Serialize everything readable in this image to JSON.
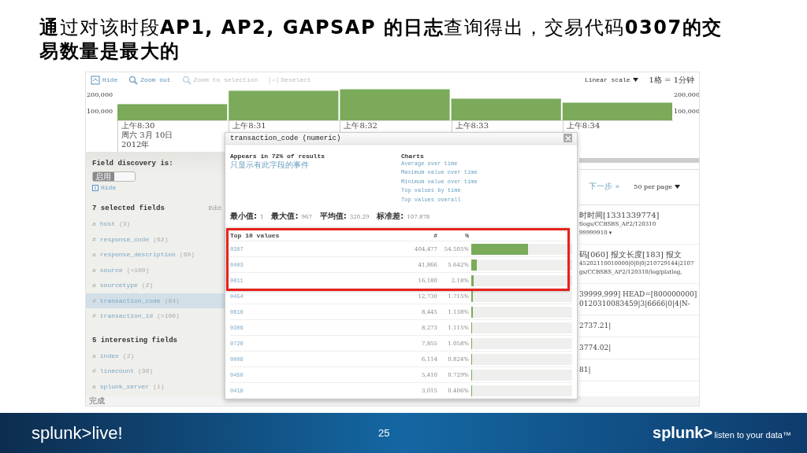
{
  "slide": {
    "title": "**通**过对该时段**AP1, AP2, GAPSAP 的日志**查询得出，交易代码**0307的交易数量是最大的**",
    "footer_logo": "splunk>live!",
    "page_number": "25",
    "footer_brand": "splunk>",
    "footer_tagline": "listen to your data™"
  },
  "toolbar": {
    "buttons": [
      {
        "kind": "hide",
        "label": "Hide",
        "disabled": false
      },
      {
        "kind": "zoom",
        "label": "Zoom out",
        "disabled": false
      },
      {
        "kind": "zoom",
        "label": "Zoom to selection",
        "disabled": true
      },
      {
        "kind": "deselect",
        "label": "Deselect",
        "disabled": true
      }
    ],
    "scale": "Linear scale",
    "bucket": "1格 = 1分钟"
  },
  "timeline": {
    "chart_data": {
      "type": "bar",
      "categories": [
        "上午8:30",
        "上午8:31",
        "上午8:32",
        "上午8:33",
        "上午8:34"
      ],
      "values": [
        148000,
        229000,
        238000,
        181000,
        157000
      ],
      "ylim": [
        50000,
        250000
      ],
      "yticks": [
        {
          "value": 100000,
          "label": "100,000"
        },
        {
          "value": 200000,
          "label": "200,000"
        }
      ]
    },
    "right_axis_labels": [
      "200,000",
      "100,000"
    ],
    "date_lines": [
      "周六 3月 10日",
      "2012年"
    ]
  },
  "sidebar": {
    "heading": "Field discovery is:",
    "toggle": {
      "label": "启用",
      "on": true
    },
    "hide": "Hide",
    "groups": [
      {
        "title": "7 selected fields",
        "action": "Edit",
        "fields": [
          {
            "type": "a",
            "name": "host",
            "count": "(3)",
            "selected": false
          },
          {
            "type": "#",
            "name": "response_code",
            "count": "(62)",
            "selected": false
          },
          {
            "type": "a",
            "name": "response_description",
            "count": "(60)",
            "selected": false
          },
          {
            "type": "a",
            "name": "source",
            "count": "(>100)",
            "selected": false
          },
          {
            "type": "a",
            "name": "sourcetype",
            "count": "(2)",
            "selected": false
          },
          {
            "type": "#",
            "name": "transaction_code",
            "count": "(84)",
            "selected": true
          },
          {
            "type": "#",
            "name": "transaction_id",
            "count": "(>100)",
            "selected": false
          }
        ]
      },
      {
        "title": "5 interesting fields",
        "fields": [
          {
            "type": "a",
            "name": "index",
            "count": "(2)",
            "selected": false
          },
          {
            "type": "#",
            "name": "linecount",
            "count": "(36)",
            "selected": false
          },
          {
            "type": "a",
            "name": "splunk_server",
            "count": "(1)",
            "selected": false
          }
        ]
      }
    ]
  },
  "results": {
    "next": "下一步 »",
    "per_page": "50 per page",
    "events": [
      {
        "title": "时时间[1331339774]",
        "lines": [
          "tlogs/CCBSBS_AP2/120310",
          "99999910 ▾"
        ]
      },
      {
        "title": "码[060] 报文长度[183] 报文",
        "lines": [
          "45202110010000|0|0|0|210729144|2107",
          "gs/CCBSBS_AP2/120310/log/platlog,"
        ]
      },
      {
        "lines": [
          "39999,999] HEAD=[800000000]",
          "0120310083459|3|6666|0|4|N-"
        ]
      },
      {
        "lines": [
          "2737.21|"
        ]
      },
      {
        "lines": [
          "3774.02|"
        ]
      },
      {
        "lines": [
          "81|"
        ]
      }
    ]
  },
  "popup": {
    "title": "transaction_code (numeric)",
    "appears": "Appears in 72% of results",
    "filter_link": "只显示有此字段的事件",
    "charts_heading": "Charts",
    "chart_links": [
      "Average over time",
      "Maximum value over time",
      "Minimum value over time",
      "Top values by time",
      "Top values overall"
    ],
    "stats": [
      {
        "label": "最小值:",
        "value": "1"
      },
      {
        "label": "最大值:",
        "value": "967"
      },
      {
        "label": "平均值:",
        "value": "320.29"
      },
      {
        "label": "标准差:",
        "value": "107.878"
      }
    ],
    "table": {
      "columns": [
        "Top 10 values",
        "#",
        "%"
      ],
      "highlighted_rows": [
        {
          "value": "0307",
          "count": "404,477",
          "percent": "54.505%",
          "level": 0.56
        },
        {
          "value": "0403",
          "count": "41,866",
          "percent": "5.642%",
          "level": 0.058
        },
        {
          "value": "0011",
          "count": "16,180",
          "percent": "2.18%",
          "level": 0.022
        }
      ],
      "rows": [
        {
          "value": "0454",
          "count": "12,730",
          "percent": "1.715%",
          "level": 0.018
        },
        {
          "value": "0610",
          "count": "8,445",
          "percent": "1.138%",
          "level": 0.012
        },
        {
          "value": "0306",
          "count": "8,273",
          "percent": "1.115%",
          "level": 0.011
        },
        {
          "value": "0720",
          "count": "7,855",
          "percent": "1.058%",
          "level": 0.011
        },
        {
          "value": "0008",
          "count": "6,114",
          "percent": "0.824%",
          "level": 0.008
        },
        {
          "value": "0450",
          "count": "5,410",
          "percent": "0.729%",
          "level": 0.008
        },
        {
          "value": "0418",
          "count": "3,015",
          "percent": "0.406%",
          "level": 0.004
        }
      ]
    }
  },
  "status_bar": {
    "text": "完成"
  }
}
